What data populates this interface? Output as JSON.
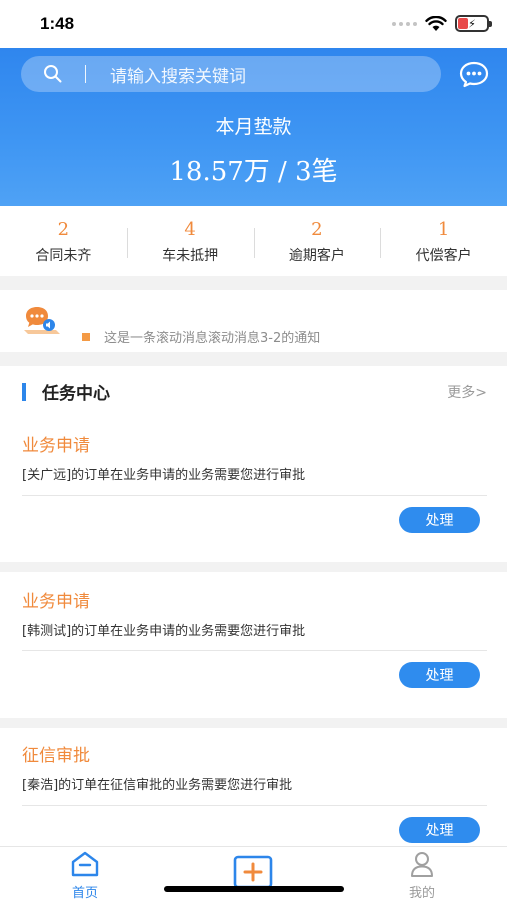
{
  "status_bar": {
    "time": "1:48"
  },
  "header": {
    "search_placeholder": "请输入搜索关键词",
    "month_title": "本月垫款",
    "month_value": "18.57万 / 3笔"
  },
  "stats": [
    {
      "value": "2",
      "label": "合同未齐"
    },
    {
      "value": "4",
      "label": "车未抵押"
    },
    {
      "value": "2",
      "label": "逾期客户"
    },
    {
      "value": "1",
      "label": "代偿客户"
    }
  ],
  "notice": {
    "text": "这是一条滚动消息滚动消息3-2的通知"
  },
  "task_center": {
    "title": "任务中心",
    "more": "更多>",
    "items": [
      {
        "title": "业务申请",
        "desc": "[关广远]的订单在业务申请的业务需要您进行审批",
        "button": "处理"
      },
      {
        "title": "业务申请",
        "desc": "[韩测试]的订单在业务申请的业务需要您进行审批",
        "button": "处理"
      },
      {
        "title": "征信审批",
        "desc": "[秦浩]的订单在征信审批的业务需要您进行审批",
        "button": "处理"
      }
    ]
  },
  "tabbar": {
    "home": "首页",
    "mine": "我的",
    "active_color": "#2d86ea"
  },
  "colors": {
    "primary": "#2f86ee",
    "accent": "#f08a3c"
  }
}
